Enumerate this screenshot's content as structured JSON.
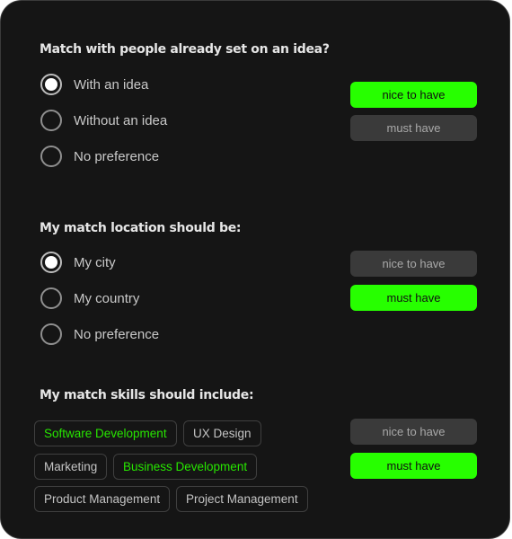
{
  "sections": [
    {
      "title": "Match with people already set on an idea?",
      "options": [
        {
          "label": "With an idea",
          "checked": true
        },
        {
          "label": "Without an idea",
          "checked": false
        },
        {
          "label": "No preference",
          "checked": false
        }
      ],
      "nice_label": "nice to have",
      "must_label": "must have",
      "selected_preference": "nice to have"
    },
    {
      "title": "My match location should be:",
      "options": [
        {
          "label": "My city",
          "checked": true
        },
        {
          "label": "My country",
          "checked": false
        },
        {
          "label": "No preference",
          "checked": false
        }
      ],
      "nice_label": "nice to have",
      "must_label": "must have",
      "selected_preference": "must have"
    },
    {
      "title": "My match skills should include:",
      "skills": [
        {
          "label": "Software Development",
          "selected": true
        },
        {
          "label": "UX Design",
          "selected": false
        },
        {
          "label": "Marketing",
          "selected": false
        },
        {
          "label": "Business Development",
          "selected": true
        },
        {
          "label": "Product Management",
          "selected": false
        },
        {
          "label": "Project Management",
          "selected": false
        }
      ],
      "nice_label": "nice to have",
      "must_label": "must have",
      "selected_preference": "must have"
    }
  ],
  "colors": {
    "accent": "#27ff00",
    "card_background": "#151515",
    "inactive_button": "#3a3a3a"
  }
}
